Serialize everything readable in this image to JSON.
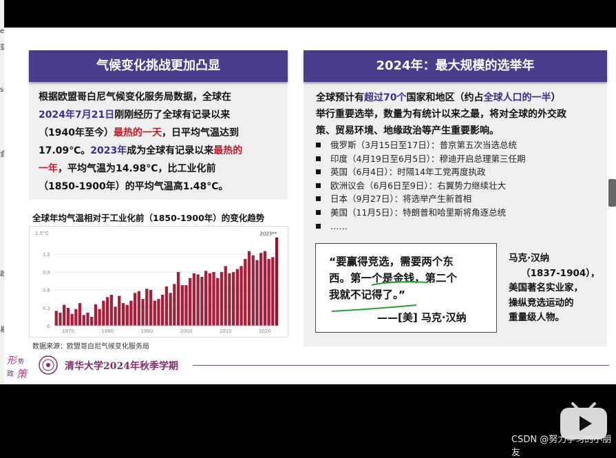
{
  "left_card": {
    "header": "气候变化挑战更加凸显",
    "p1": "根据欧盟哥白尼气候变化服务局数据，全球在",
    "date": "2024年7月21日",
    "p2": "刚刚经历了全球有记录以来",
    "p3": "（1940年至今）",
    "hottest_day": "最热的一天",
    "p4": "，日平均气温达到",
    "p5": "17.09℃。",
    "year2023": "2023年",
    "p6": "成为全球有记录以来",
    "hottest_year_a": "最热的",
    "hottest_year_b": "一年",
    "p7": "，平均气温为14.98°C，比工业化前",
    "p8": "（1850-1900年）的平均气温高1.48°C。",
    "chart_title": "全球年均气温相对于工业化前（1850-1900年）的变化趋势",
    "chart_source": "数据来源：欧盟哥白尼气候变化服务局"
  },
  "chart_data": {
    "type": "bar",
    "ylabel": "",
    "y_unit_label": "1.5°C",
    "ylim": [
      0,
      1.5
    ],
    "y_ticks": [
      "1.2",
      "0.9",
      "0.6",
      "0.3",
      "0"
    ],
    "x_ticks": [
      "1970",
      "1980",
      "1990",
      "2000",
      "2010",
      "2020"
    ],
    "annotation": "2023**",
    "x": [
      1967,
      1968,
      1969,
      1970,
      1971,
      1972,
      1973,
      1974,
      1975,
      1976,
      1977,
      1978,
      1979,
      1980,
      1981,
      1982,
      1983,
      1984,
      1985,
      1986,
      1987,
      1988,
      1989,
      1990,
      1991,
      1992,
      1993,
      1994,
      1995,
      1996,
      1997,
      1998,
      1999,
      2000,
      2001,
      2002,
      2003,
      2004,
      2005,
      2006,
      2007,
      2008,
      2009,
      2010,
      2011,
      2012,
      2013,
      2014,
      2015,
      2016,
      2017,
      2018,
      2019,
      2020,
      2021,
      2022,
      2023
    ],
    "values": [
      0.25,
      0.22,
      0.35,
      0.3,
      0.2,
      0.28,
      0.38,
      0.18,
      0.22,
      0.15,
      0.36,
      0.28,
      0.42,
      0.48,
      0.52,
      0.32,
      0.5,
      0.38,
      0.35,
      0.42,
      0.55,
      0.58,
      0.45,
      0.62,
      0.6,
      0.42,
      0.45,
      0.52,
      0.66,
      0.55,
      0.7,
      0.9,
      0.68,
      0.68,
      0.8,
      0.88,
      0.86,
      0.82,
      0.92,
      0.88,
      0.9,
      0.8,
      0.9,
      1.0,
      0.88,
      0.9,
      0.95,
      1.0,
      1.12,
      1.25,
      1.18,
      1.1,
      1.22,
      1.25,
      1.12,
      1.15,
      1.48
    ],
    "colors": {
      "bar": "#a51f3a",
      "highlight": "#8a1630"
    }
  },
  "right_card": {
    "header": "2024年：最大规模的选举年",
    "p1a": "全球预计有",
    "p1b": "超过70个",
    "p1c": "国家和地区（约占",
    "p1d": "全球人口的一半",
    "p1e": "）",
    "p2": "举行重要选举，数量为有统计以来之最，将对全球的外交政",
    "p3": "策、贸易环境、地缘政治等产生重要影响。",
    "bullets": [
      "俄罗斯（3月15日至17日）：普京第五次当选总统",
      "印度（4月19日至6月5日）：穆迪开启总理第三任期",
      "英国（6月4日）：时隔14年工党再度执政",
      "欧洲议会（6月6日至9日）：右翼势力继续壮大",
      "日本（9月27日）：将选举产生新首相",
      "美国（11月5日）：特朗普和哈里斯将角逐总统",
      "……"
    ],
    "quote_l1": "“要赢得竞选，需要两个东",
    "quote_l2": "西。第一个是金钱，第二个",
    "quote_l3": "我就不记得了。”",
    "quote_by": "——[美] 马克·汉纳",
    "bio_l1": "马克·汉纳",
    "bio_l2": "（1837-1904），",
    "bio_l3": "美国著名实业家，",
    "bio_l4": "操纵竞选运动的",
    "bio_l5": "重量级人物。"
  },
  "footer": {
    "text": "清华大学2024年秋季学期",
    "logo_text": "形势与政策"
  },
  "watermark": "CSDN @努力学习的小朋友",
  "left_edge_chars": [
    "e",
    "亚",
    "s",
    "会",
    "政",
    "易"
  ],
  "colors": {
    "header_bg": "#4b3c8c",
    "accent_blue": "#3a2f8f",
    "accent_red": "#c0192a",
    "footer_purple": "#7c2f6c"
  }
}
